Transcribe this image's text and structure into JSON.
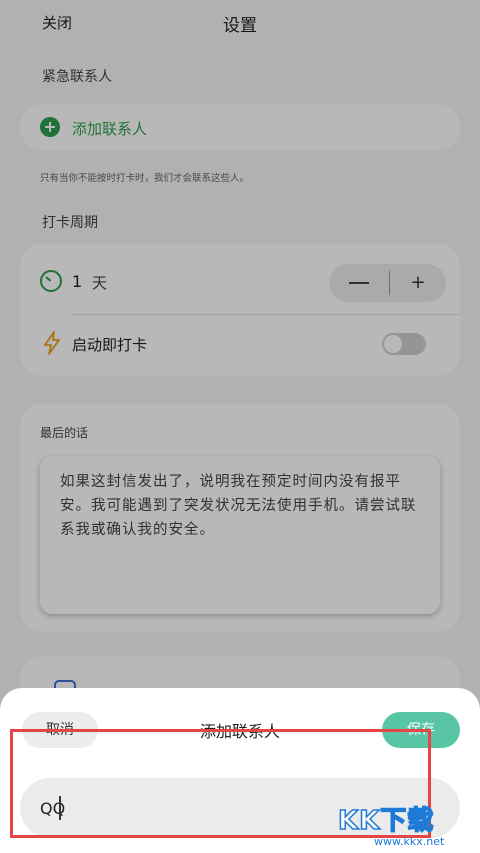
{
  "header": {
    "close_label": "关闭",
    "title": "设置"
  },
  "emergency": {
    "section_label": "紧急联系人",
    "add_label": "添加联系人",
    "hint": "只有当你不能按时打卡时，我们才会联系这些人。"
  },
  "checkin": {
    "section_label": "打卡周期",
    "days_value": "1",
    "days_unit": "天",
    "minus_label": "",
    "plus_label": "+",
    "launch_label": "启动即打卡",
    "launch_enabled": false
  },
  "last_words": {
    "section_label": "最后的话",
    "text": "如果这封信发出了，说明我在预定时间内没有报平安。我可能遇到了突发状况无法使用手机。请尝试联系我或确认我的安全。"
  },
  "sheet": {
    "cancel_label": "取消",
    "title": "添加联系人",
    "save_label": "保存",
    "input_value": "QQ"
  },
  "watermark": {
    "main": "KK下载",
    "sub": "www.kkx.net"
  },
  "colors": {
    "accent_green": "#2e9e4f",
    "save_teal": "#58c6a4",
    "highlight_red": "#e64545",
    "watermark_blue": "#1e7ad6"
  },
  "icons": {
    "add": "plus-circle-icon",
    "cycle": "clock-icon",
    "launch": "lightning-bolt-icon"
  }
}
